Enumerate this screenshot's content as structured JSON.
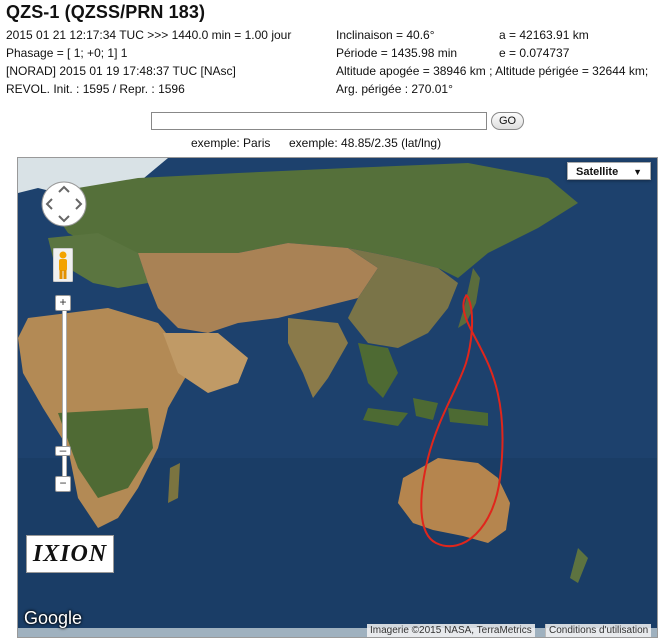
{
  "header": {
    "title": "QZS-1 (QZSS/PRN 183)"
  },
  "info": {
    "col1": [
      "2015 01 21 12:17:34 TUC >>> 1440.0 min = 1.00 jour",
      "Phasage = [ 1; +0; 1] 1",
      "[NORAD] 2015 01 19 17:48:37 TUC [NAsc]",
      "REVOL. Init. : 1595 / Repr. : 1596"
    ],
    "col2": [
      "Inclinaison = 40.6°",
      "Période = 1435.98 min",
      "Altitude apogée = 38946 km ; Altitude périgée = 32644 km;",
      "Arg. périgée : 270.01°"
    ],
    "col3": [
      "a = 42163.91 km",
      "e = 0.074737"
    ]
  },
  "search": {
    "value": "",
    "go_label": "GO",
    "hint_city": "exemple: Paris",
    "hint_coords": "exemple: 48.85/2.35 (lat/lng)"
  },
  "map": {
    "type_selected": "Satellite",
    "logo_text": "IXION",
    "google_text": "Google",
    "attribution": "Imagerie ©2015 NASA, TerraMetrics",
    "terms": "Conditions d'utilisation",
    "icons": [
      "pan-control-icon",
      "pegman-icon",
      "zoom-in-icon",
      "zoom-out-icon",
      "dropdown-caret-icon"
    ],
    "colors": {
      "ocean": "#1c3f6b",
      "land_dry": "#b58a55",
      "land_green": "#4f6a36",
      "ice": "#dfe6ea",
      "orbit": "#e0261c"
    }
  }
}
